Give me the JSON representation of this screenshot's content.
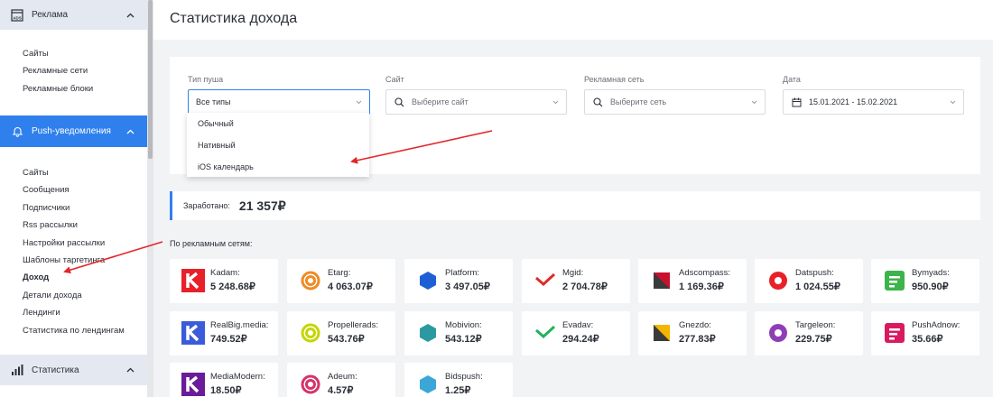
{
  "sidebar": {
    "sections": [
      {
        "title": "Реклама",
        "icon": "ads-icon",
        "items": [
          "Сайты",
          "Рекламные сети",
          "Рекламные блоки"
        ]
      },
      {
        "title": "Push-уведомления",
        "icon": "bell-icon",
        "items": [
          "Сайты",
          "Сообщения",
          "Подписчики",
          "Rss рассылки",
          "Настройки рассылки",
          "Шаблоны таргетинга",
          "Доход",
          "Детали дохода",
          "Лендинги",
          "Статистика по лендингам"
        ],
        "active_item": "Доход"
      },
      {
        "title": "Статистика",
        "icon": "stats-chart-icon"
      }
    ]
  },
  "page": {
    "title": "Статистика дохода"
  },
  "filters": {
    "push_type": {
      "label": "Тип пуша",
      "value": "Все типы",
      "options": [
        "Обычный",
        "Нативный",
        "iOS календарь"
      ]
    },
    "site": {
      "label": "Сайт",
      "placeholder": "Выберите сайт"
    },
    "network": {
      "label": "Рекламная сеть",
      "placeholder": "Выберите сеть"
    },
    "date": {
      "label": "Дата",
      "value": "15.01.2021 - 15.02.2021"
    }
  },
  "earned": {
    "label": "Заработано:",
    "amount": "21 357₽"
  },
  "networks_title": "По рекламным сетям:",
  "networks": [
    {
      "name": "Kadam:",
      "amount": "5 248.68₽",
      "logo_color": "#e8202a"
    },
    {
      "name": "Etarg:",
      "amount": "4 063.07₽",
      "logo_color": "#f08a24"
    },
    {
      "name": "Platform:",
      "amount": "3 497.05₽",
      "logo_color": "#1f5fd6"
    },
    {
      "name": "Mgid:",
      "amount": "2 704.78₽",
      "logo_color": "#e02a2a"
    },
    {
      "name": "Adscompass:",
      "amount": "1 169.36₽",
      "logo_color": "#c8102e"
    },
    {
      "name": "Datspush:",
      "amount": "1 024.55₽",
      "logo_color": "#e8202a"
    },
    {
      "name": "Bymyads:",
      "amount": "950.90₽",
      "logo_color": "#3cb44b"
    },
    {
      "name": "RealBig.media:",
      "amount": "749.52₽",
      "logo_color": "#3b5bdb"
    },
    {
      "name": "Propellerads:",
      "amount": "543.76₽",
      "logo_color": "#c4d600"
    },
    {
      "name": "Mobivion:",
      "amount": "543.12₽",
      "logo_color": "#2b9aa0"
    },
    {
      "name": "Evadav:",
      "amount": "294.24₽",
      "logo_color": "#1fb35a"
    },
    {
      "name": "Gnezdo:",
      "amount": "277.83₽",
      "logo_color": "#f4b400"
    },
    {
      "name": "Targeleon:",
      "amount": "229.75₽",
      "logo_color": "#8e3fb8"
    },
    {
      "name": "PushAdnow:",
      "amount": "35.66₽",
      "logo_color": "#d81b60"
    },
    {
      "name": "MediaModern:",
      "amount": "18.50₽",
      "logo_color": "#6a1b9a"
    },
    {
      "name": "Adeum:",
      "amount": "4.57₽",
      "logo_color": "#d6336c"
    },
    {
      "name": "Bidspush:",
      "amount": "1.25₽",
      "logo_color": "#3aa7d6"
    }
  ]
}
